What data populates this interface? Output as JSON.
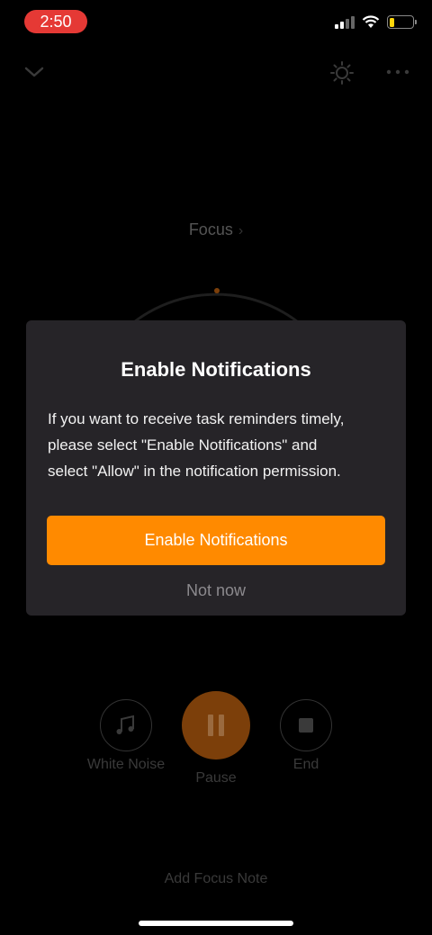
{
  "status_bar": {
    "time": "2:50",
    "battery_level": 0.2
  },
  "background": {
    "focus_label": "Focus",
    "controls": {
      "white_noise_label": "White Noise",
      "pause_label": "Pause",
      "end_label": "End"
    },
    "add_focus_note": "Add Focus Note"
  },
  "dialog": {
    "title": "Enable Notifications",
    "message_line1": "If you want to receive task reminders timely,",
    "message_line2": "please select \"Enable Notifications\" and",
    "message_line3": "select \"Allow\" in the notification permission.",
    "primary_button": "Enable Notifications",
    "secondary_button": "Not now"
  },
  "colors": {
    "accent": "#ff8a00",
    "dialog_bg": "#262428",
    "time_pill": "#e53935"
  },
  "icons": [
    "chevron-down-icon",
    "brightness-icon",
    "more-icon",
    "music-note-icon",
    "pause-icon",
    "stop-icon",
    "signal-icon",
    "wifi-icon",
    "battery-icon"
  ]
}
